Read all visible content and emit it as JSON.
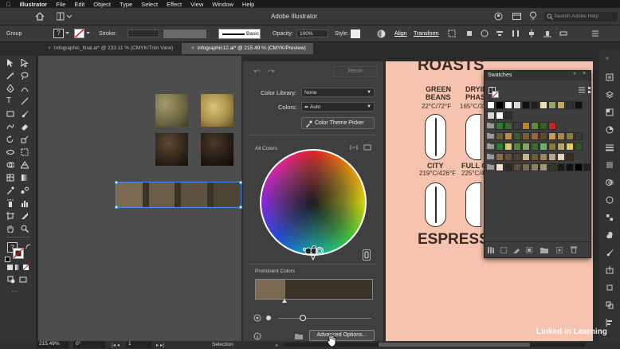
{
  "menubar": {
    "items": [
      "Illustrator",
      "File",
      "Edit",
      "Object",
      "Type",
      "Select",
      "Effect",
      "View",
      "Window",
      "Help"
    ]
  },
  "appbar": {
    "title": "Adobe Illustrator",
    "search_placeholder": "Search Adobe Help"
  },
  "control_bar": {
    "selection_label": "Group",
    "stroke_label": "Stroke:",
    "brush_label": "Basic",
    "opacity_label": "Opacity:",
    "opacity_value": "100%",
    "style_label": "Style:",
    "align_label": "Align",
    "transform_label": "Transform"
  },
  "tabs": [
    {
      "label": "Infographic_final.ai* @ 233.11 % (CMYK/Trim View)"
    },
    {
      "label": "infographic12.ai* @ 215.49 % (CMYK/Preview)"
    }
  ],
  "dialog": {
    "reset_label": "Reset",
    "color_library_label": "Color Library:",
    "color_library_value": "None",
    "colors_label": "Colors:",
    "colors_value": "Auto",
    "theme_picker_label": "Color Theme Picker",
    "all_colors_label": "All Colors",
    "prominent_label": "Prominent Colors",
    "advanced_label": "Advanced Options...",
    "prominent_colors": [
      "#7a6a52",
      "#3a3428"
    ]
  },
  "artboard": {
    "heading_top": "ROASTS",
    "items": [
      {
        "name": "GREEN BEANS",
        "temp": "22°C/72°F"
      },
      {
        "name": "DRYING PHASE",
        "temp": "165°C/329°F"
      },
      {
        "name": "CITY",
        "temp": "219°C/426°F"
      },
      {
        "name": "FULL CITY",
        "temp": "225°C/437°F"
      }
    ],
    "heading_bottom": "ESPRESSO"
  },
  "swatches_panel": {
    "title": "Swatches"
  },
  "status": {
    "zoom": "215.49%",
    "rotation": "0°",
    "artboard_num": "1",
    "tool": "Selection"
  },
  "watermark": "Linked in Learning",
  "colors": {
    "artboard": "#f6c3ae",
    "accent_blue": "#3d7ad7",
    "swatch_rows": [
      [
        "#ffffff",
        "#000000",
        "#ffffff",
        "#d9d9d9",
        "#111111",
        "#1f1f1f",
        "#e8dfb0",
        "#9aa372",
        "#c4a85e",
        "#313131",
        "#111111"
      ],
      [
        "#d6d6d6",
        "#ffffff",
        "#2c2c2c"
      ],
      [
        "#2e7d32",
        "#3a6b2f",
        "#3d3d3d",
        "#b5842f",
        "#5f8a3a",
        "#355e2a",
        "#c62828"
      ],
      [
        "#6b5a38",
        "#b98e4b",
        "#3a5a2f",
        "#7a5c2e",
        "#8d6a3c",
        "#5c4b32",
        "#c49a58",
        "#a3874f",
        "#8e7a45",
        "#3a3a3a"
      ],
      [
        "#2e7d32",
        "#d7c97a",
        "#558b3a",
        "#86a96b",
        "#3a6d33",
        "#6fb06b",
        "#8a7a3e",
        "#bba36a",
        "#e8c76a",
        "#2a5c2a"
      ],
      [
        "#8a6f4a",
        "#6a5238",
        "#514030",
        "#cbb28f",
        "#6e5b40",
        "#9b8363",
        "#bda58a",
        "#e5d2b9",
        "#3a2e22"
      ],
      [
        "#efe3c7",
        "#2a2a2a",
        "#5c4d3a",
        "#7a6a52",
        "#8e7d60",
        "#a89776",
        "#3a3428",
        "#1e1b15",
        "#111111",
        "#000000",
        "#222222"
      ]
    ]
  }
}
